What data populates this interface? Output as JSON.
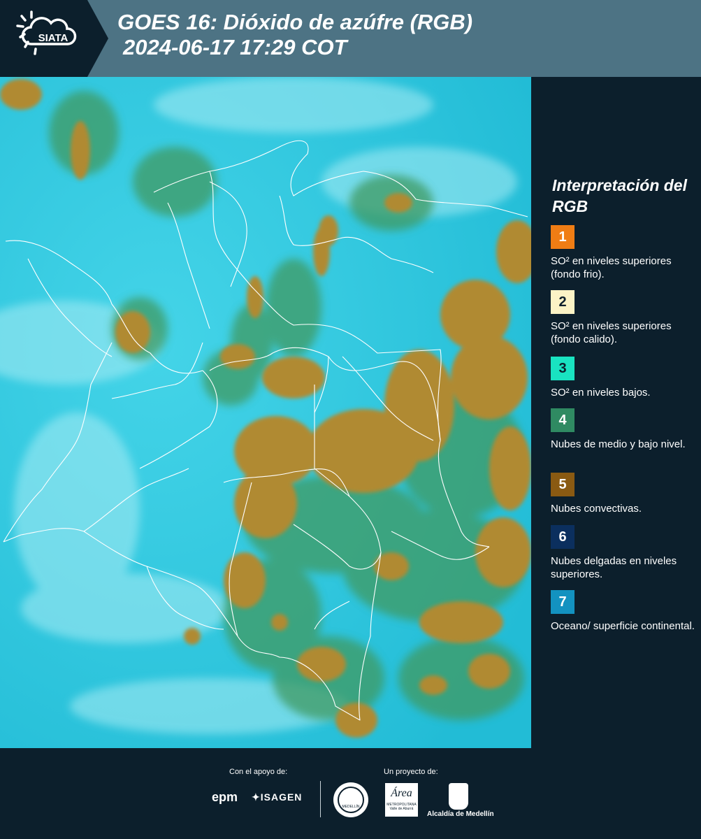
{
  "header": {
    "logo_text": "SIATA",
    "title_line1": "GOES 16: Dióxido de azúfre (RGB)",
    "title_line2": "2024-06-17 17:29 COT"
  },
  "legend": {
    "title": "Interpretación del RGB",
    "items": [
      {
        "number": "1",
        "color": "#f07d14",
        "number_color": "#ffffff",
        "text": "SO² en niveles superiores (fondo frio)."
      },
      {
        "number": "2",
        "color": "#fbf3c6",
        "number_color": "#0c1f2c",
        "text": "SO² en niveles superiores (fondo calido)."
      },
      {
        "number": "3",
        "color": "#19e3c1",
        "number_color": "#0c1f2c",
        "text": "SO² en niveles bajos."
      },
      {
        "number": "4",
        "color": "#2f8a62",
        "number_color": "#ffffff",
        "text": "Nubes de medio y bajo nivel."
      },
      {
        "number": "5",
        "color": "#8a5a12",
        "number_color": "#ffffff",
        "text": "Nubes convectivas."
      },
      {
        "number": "6",
        "color": "#0b2f5e",
        "number_color": "#ffffff",
        "text": "Nubes delgadas en niveles superiores."
      },
      {
        "number": "7",
        "color": "#1392c0",
        "number_color": "#ffffff",
        "text": "Oceano/ superficie continental."
      }
    ]
  },
  "footer": {
    "support_label": "Con el apoyo de:",
    "project_label": "Un proyecto de:",
    "sponsor_1": "epm",
    "sponsor_2": "ISAGEN",
    "org_1_text": "MEDELLÍN",
    "org_2_text": "Área",
    "org_2_subtext": "METROPOLITANA Valle de Aburrá",
    "org_3_text": "Alcaldía de Medellín"
  },
  "colors": {
    "header_bg": "#4d7384",
    "logo_bg": "#0c1f2c",
    "panel_bg": "#0c1f2c",
    "map_background": "#35cbe0",
    "cloud_convective": "#b08a33",
    "cloud_green": "#2f8a62"
  }
}
